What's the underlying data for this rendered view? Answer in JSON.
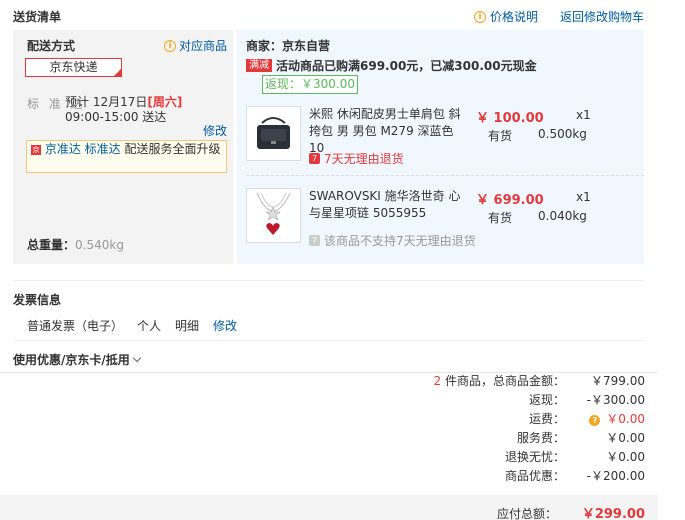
{
  "header": {
    "title": "送货清单",
    "price_help": "价格说明",
    "back_to_cart": "返回修改购物车"
  },
  "shipping": {
    "label": "配送方式",
    "match_goods": "对应商品",
    "carrier": "京东快递",
    "std_label": "标 准 达",
    "std_date_prefix": "预计 12月17日",
    "std_weekday": "[周六]",
    "std_time": "09:00-15:00 送达",
    "modify": "修改",
    "upgrade_tag": "京",
    "upgrade_a": "京准达",
    "upgrade_b": "标准达",
    "upgrade_text": "配送服务全面升级",
    "weight_label": "总重量：",
    "weight_value": "0.540kg"
  },
  "merchant": {
    "name": "商家：京东自营",
    "promo_tag": "满减",
    "promo_text": "活动商品已购满699.00元，已减300.00元现金",
    "rebate": "返现：￥300.00"
  },
  "items": [
    {
      "title": "米熙 休闲配皮男士单肩包 斜挎包 男 男包 M279 深蓝色 10",
      "price": "￥ 100.00",
      "qty": "x1",
      "stock": "有货",
      "weight": "0.500kg",
      "service_icon": "7",
      "service": "7天无理由退货",
      "icon": "shoulder-bag-icon"
    },
    {
      "title": "SWAROVSKI 施华洛世奇 心与星星项链 5055955",
      "price": "￥ 699.00",
      "qty": "x1",
      "stock": "有货",
      "weight": "0.040kg",
      "service_icon": "7",
      "service": "该商品不支持7天无理由退货",
      "icon": "necklace-icon"
    }
  ],
  "invoice": {
    "title": "发票信息",
    "type": "普通发票（电子）",
    "owner": "个人",
    "detail": "明细",
    "modify": "修改"
  },
  "coupon": {
    "title": "使用优惠/京东卡/抵用"
  },
  "summary": {
    "count": "2",
    "count_suffix": "件商品，总商品金额：",
    "goods_total": "￥799.00",
    "rebate_label": "返现：",
    "rebate_value": "-￥300.00",
    "freight_label": "运费：",
    "freight_value": "￥0.00",
    "service_fee_label": "服务费：",
    "service_fee_value": "￥0.00",
    "return_worry_label": "退换无忧：",
    "return_worry_value": "￥0.00",
    "discount_label": "商品优惠：",
    "discount_value": "-￥200.00",
    "payable_label": "应付总额：",
    "payable_value": "￥299.00"
  }
}
